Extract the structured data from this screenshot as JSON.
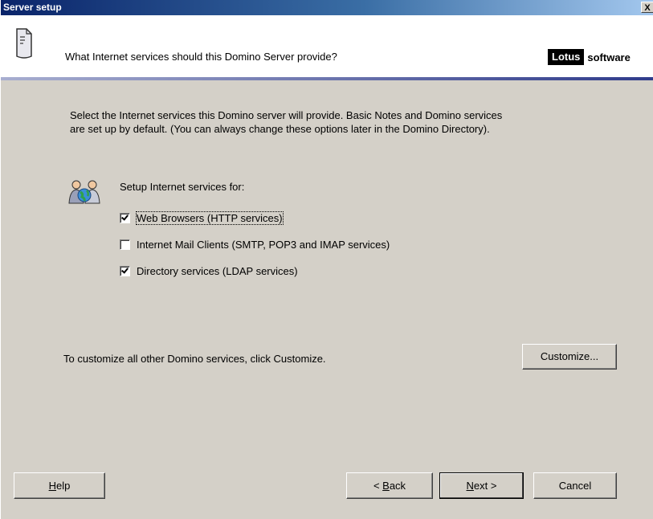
{
  "window": {
    "title": "Server setup",
    "close_label": "X"
  },
  "header": {
    "question": "What Internet services should this Domino Server provide?",
    "logo_brand": "Lotus",
    "logo_suffix": "software"
  },
  "intro": {
    "line1": "Select the Internet services this Domino server will provide. Basic Notes and Domino services",
    "line2": "are set up by default. (You can always change these options later in the Domino Directory)."
  },
  "services": {
    "heading": "Setup Internet services for:",
    "items": [
      {
        "label": "Web Browsers (HTTP services)",
        "checked": true,
        "focused": true
      },
      {
        "label": "Internet Mail Clients (SMTP, POP3 and IMAP services)",
        "checked": false,
        "focused": false
      },
      {
        "label": "Directory services (LDAP services)",
        "checked": true,
        "focused": false
      }
    ]
  },
  "customize": {
    "text": "To customize all other Domino services, click Customize.",
    "button_label": "Customize..."
  },
  "buttons": {
    "help_mnemonic": "H",
    "help_rest": "elp",
    "back_prefix": "< ",
    "back_mnemonic": "B",
    "back_rest": "ack",
    "next_mnemonic": "N",
    "next_rest": "ext >",
    "cancel": "Cancel"
  },
  "icons": {
    "page": "server-document-icon",
    "people": "people-globe-icon"
  }
}
